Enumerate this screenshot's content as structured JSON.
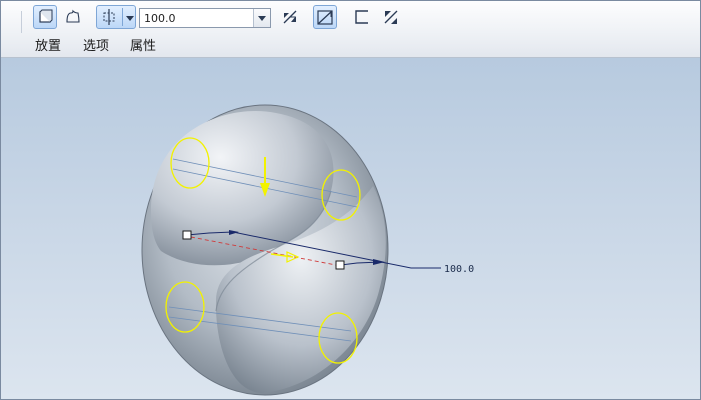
{
  "toolbar": {
    "value_input": "100.0",
    "icons": [
      "solid-icon",
      "surface-icon",
      "depth-option-icon",
      "dropdown-arrow-icon",
      "flip-direction-icon",
      "remove-material-icon",
      "thicken-icon",
      "flip-thicken-icon"
    ]
  },
  "tabs": [
    "放置",
    "选项",
    "属性"
  ],
  "viewport": {
    "dimension_label": "100.0",
    "colors": {
      "handle_yellow": "#f2f200",
      "dimension_line": "#1a2a6a",
      "section_line": "#d03a3a"
    }
  }
}
